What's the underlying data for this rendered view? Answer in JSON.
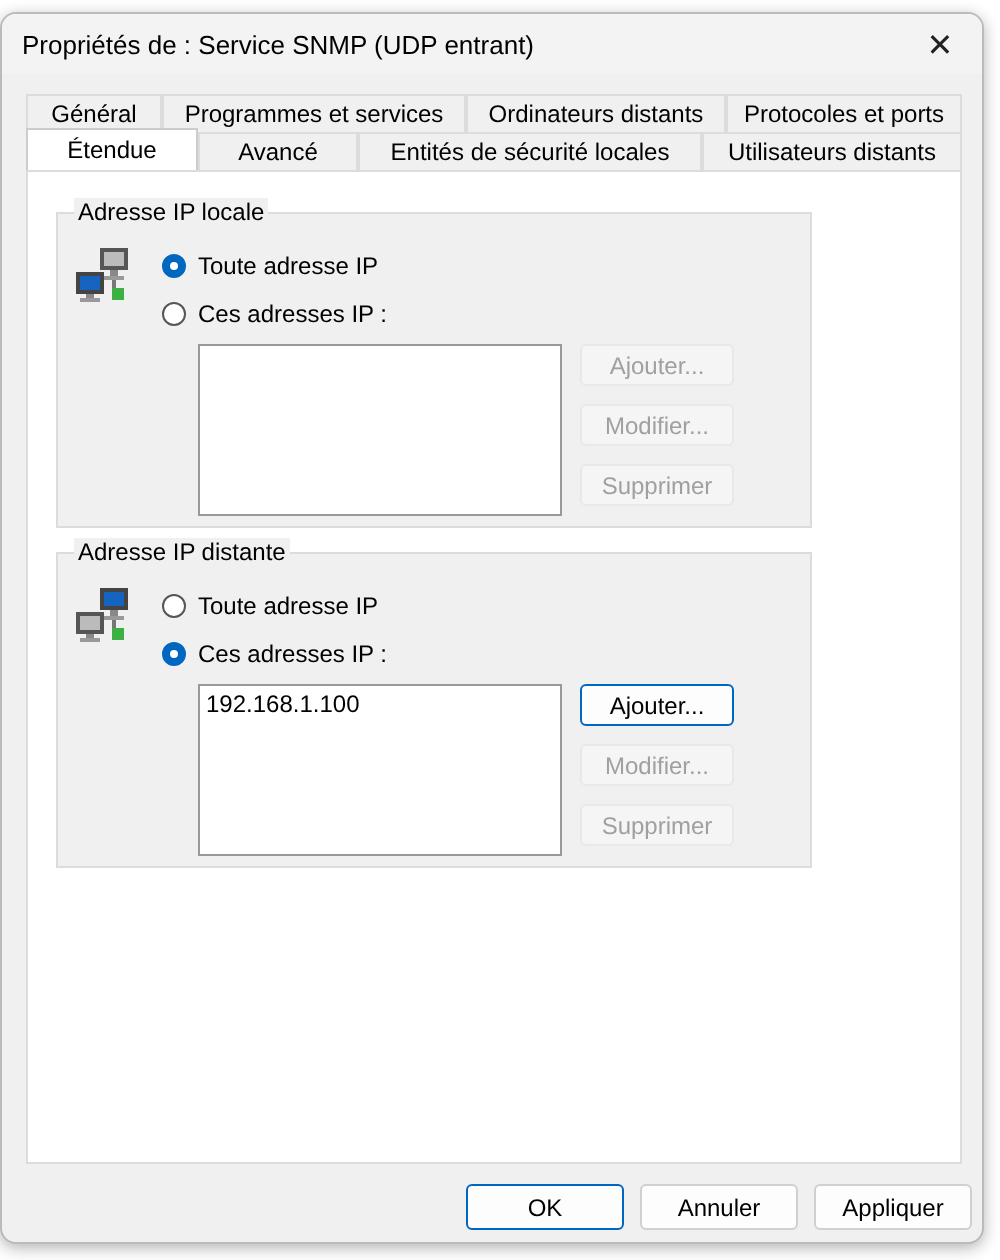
{
  "window": {
    "title": "Propriétés de : Service SNMP (UDP entrant)",
    "close": "✕"
  },
  "tab_rows": [
    [
      {
        "label": "Général",
        "selected": false
      },
      {
        "label": "Programmes et services",
        "selected": false
      },
      {
        "label": "Ordinateurs distants",
        "selected": false
      },
      {
        "label": "Protocoles et ports",
        "selected": false
      }
    ],
    [
      {
        "label": "Étendue",
        "selected": true
      },
      {
        "label": "Avancé",
        "selected": false
      },
      {
        "label": "Entités de sécurité locales",
        "selected": false
      },
      {
        "label": "Utilisateurs distants",
        "selected": false
      }
    ]
  ],
  "groups": [
    {
      "title": "Adresse IP locale",
      "kind": "local",
      "options": [
        {
          "label": "Toute adresse IP",
          "selected": true
        },
        {
          "label": "Ces adresses IP :",
          "selected": false
        }
      ],
      "buttons": [
        {
          "label": "Ajouter...",
          "disabled": true
        },
        {
          "label": "Modifier...",
          "disabled": true
        },
        {
          "label": "Supprimer",
          "disabled": true
        }
      ]
    },
    {
      "title": "Adresse IP distante",
      "kind": "remote",
      "options": [
        {
          "label": "Toute adresse IP",
          "selected": false
        },
        {
          "label": "Ces adresses IP :",
          "selected": true
        }
      ],
      "addresses": [
        "192.168.1.100"
      ],
      "buttons": [
        {
          "label": "Ajouter...",
          "disabled": false
        },
        {
          "label": "Modifier...",
          "disabled": true
        },
        {
          "label": "Supprimer",
          "disabled": true
        }
      ]
    }
  ],
  "footer_buttons": [
    {
      "label": "OK",
      "default": true
    },
    {
      "label": "Annuler",
      "default": false
    },
    {
      "label": "Appliquer",
      "default": false
    }
  ]
}
